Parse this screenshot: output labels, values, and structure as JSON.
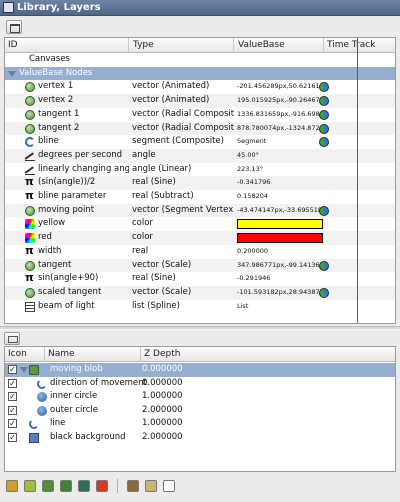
{
  "window": {
    "title": "Library, Layers"
  },
  "params_panel": {
    "columns": [
      "ID",
      "Type",
      "ValueBase",
      "Time Track"
    ],
    "rows": [
      {
        "id": "Canvases",
        "type": "",
        "value": "",
        "icon": "none-icon",
        "kind": "plain"
      },
      {
        "id": "ValueBase Nodes",
        "type": "",
        "value": "",
        "icon": "expander-icon",
        "kind": "header"
      },
      {
        "id": "vertex 1",
        "type": "vector (Animated)",
        "value": "-201.456289px,50.62161",
        "icon": "vector-icon",
        "waypoint": true
      },
      {
        "id": "vertex 2",
        "type": "vector (Animated)",
        "value": "195.015925px,-90.26467",
        "icon": "vector-icon",
        "waypoint": true
      },
      {
        "id": "tangent 1",
        "type": "vector (Radial Composite)",
        "value": "1336.831659px,-916.698",
        "icon": "vector-icon",
        "waypoint": true
      },
      {
        "id": "tangent 2",
        "type": "vector (Radial Composite)",
        "value": "878.780074px,-1324.872",
        "icon": "vector-icon",
        "waypoint": true
      },
      {
        "id": "bline",
        "type": "segment (Composite)",
        "value": "Segment",
        "icon": "bline-icon",
        "waypoint": true
      },
      {
        "id": "degrees per second",
        "type": "angle",
        "value": "45.00°",
        "icon": "angle-icon"
      },
      {
        "id": "linearly changing angle",
        "type": "angle (Linear)",
        "value": "223.13°",
        "icon": "angle-icon"
      },
      {
        "id": "(sin(angle))/2",
        "type": "real (Sine)",
        "value": "-0.341796",
        "icon": "real-icon"
      },
      {
        "id": "bline parameter",
        "type": "real (Subtract)",
        "value": "0.158204",
        "icon": "real-icon"
      },
      {
        "id": "moving point",
        "type": "vector (Segment Vertex)",
        "value": "-43.474147px,-33.695518",
        "icon": "vector-icon",
        "waypoint": true
      },
      {
        "id": "yellow",
        "type": "color",
        "value": "",
        "icon": "color-icon",
        "swatch": "#ffff00"
      },
      {
        "id": "red",
        "type": "color",
        "value": "",
        "icon": "color-icon",
        "swatch": "#ff0000"
      },
      {
        "id": "width",
        "type": "real",
        "value": "0.200000",
        "icon": "real-icon"
      },
      {
        "id": "tangent",
        "type": "vector (Scale)",
        "value": "347.986771px,-99.141367",
        "icon": "vector-icon",
        "waypoint": true
      },
      {
        "id": "sin(angle+90)",
        "type": "real (Sine)",
        "value": "-0.291946",
        "icon": "real-icon"
      },
      {
        "id": "scaled tangent",
        "type": "vector (Scale)",
        "value": "-101.593182px,28.943875",
        "icon": "vector-icon",
        "waypoint": true
      },
      {
        "id": "beam of light",
        "type": "list (Spline)",
        "value": "List",
        "icon": "list-icon"
      }
    ]
  },
  "layers_panel": {
    "columns": [
      "Icon",
      "Name",
      "Z Depth"
    ],
    "rows": [
      {
        "name": "moving blob",
        "z": "0.000000",
        "icon": "folder-icon",
        "checked": true,
        "selected": true,
        "indent": 0
      },
      {
        "name": "direction of movement",
        "z": "0.000000",
        "icon": "curve-icon",
        "checked": true,
        "indent": 1
      },
      {
        "name": "inner circle",
        "z": "1.000000",
        "icon": "circle-icon",
        "checked": true,
        "indent": 1
      },
      {
        "name": "outer circle",
        "z": "2.000000",
        "icon": "circle-icon",
        "checked": true,
        "indent": 1
      },
      {
        "name": "line",
        "z": "1.000000",
        "icon": "curve-icon",
        "checked": true,
        "indent": 0
      },
      {
        "name": "black background",
        "z": "2.000000",
        "icon": "rectangle-icon",
        "checked": true,
        "indent": 0
      }
    ]
  },
  "bottom_toolbar": [
    {
      "icon": "raise-layer-icon",
      "color": "#c9a227"
    },
    {
      "icon": "lower-layer-icon",
      "color": "#9fbf3b"
    },
    {
      "icon": "duplicate-layer-icon",
      "color": "#4f8f3c"
    },
    {
      "icon": "encapsulate-icon",
      "color": "#3f7f3a"
    },
    {
      "icon": "encapsulate-switch-icon",
      "color": "#2e6e5a"
    },
    {
      "icon": "delete-layer-icon",
      "color": "#d23a2a"
    },
    {
      "icon": "cut-icon",
      "color": "#8a6a3a"
    },
    {
      "icon": "paste-icon",
      "color": "#c7b770"
    },
    {
      "icon": "copy-icon",
      "color": "#ffffff"
    }
  ]
}
